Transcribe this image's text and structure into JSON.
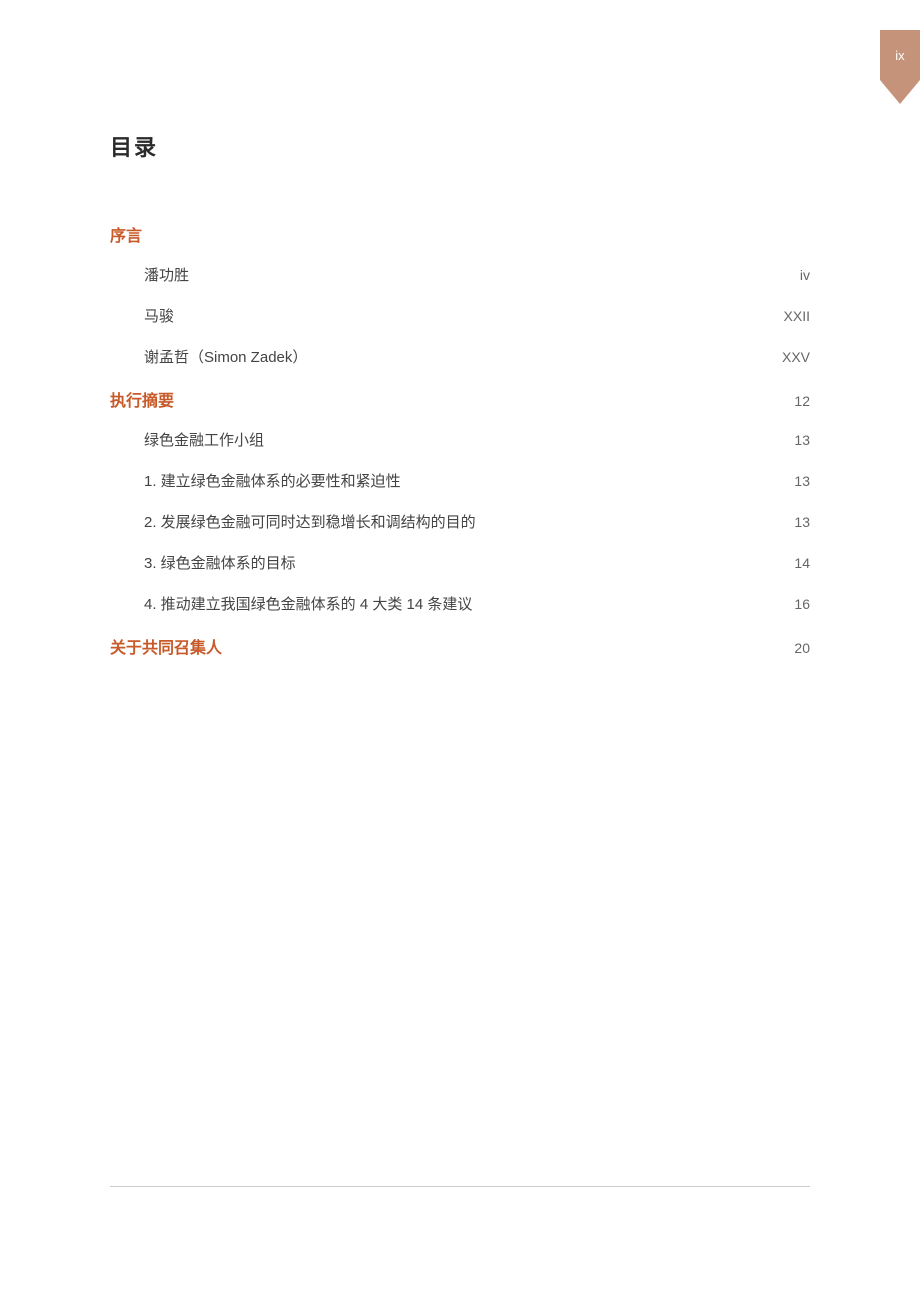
{
  "pageTab": "ix",
  "title": "目录",
  "sections": [
    {
      "heading": "序言",
      "headingPage": "",
      "entries": [
        {
          "label": "潘功胜",
          "page": "iv"
        },
        {
          "label": "马骏",
          "page": "XXII"
        },
        {
          "label": "谢孟哲（Simon Zadek）",
          "page": "XXV"
        }
      ]
    },
    {
      "heading": "执行摘要",
      "headingPage": "12",
      "entries": [
        {
          "label": "绿色金融工作小组",
          "page": "13"
        },
        {
          "label": "1. 建立绿色金融体系的必要性和紧迫性",
          "page": "13"
        },
        {
          "label": "2. 发展绿色金融可同时达到稳增长和调结构的目的",
          "page": "13"
        },
        {
          "label": "3. 绿色金融体系的目标",
          "page": "14"
        },
        {
          "label": "4. 推动建立我国绿色金融体系的 4 大类 14 条建议",
          "page": "16"
        }
      ]
    },
    {
      "heading": "关于共同召集人",
      "headingPage": "20",
      "entries": []
    }
  ]
}
